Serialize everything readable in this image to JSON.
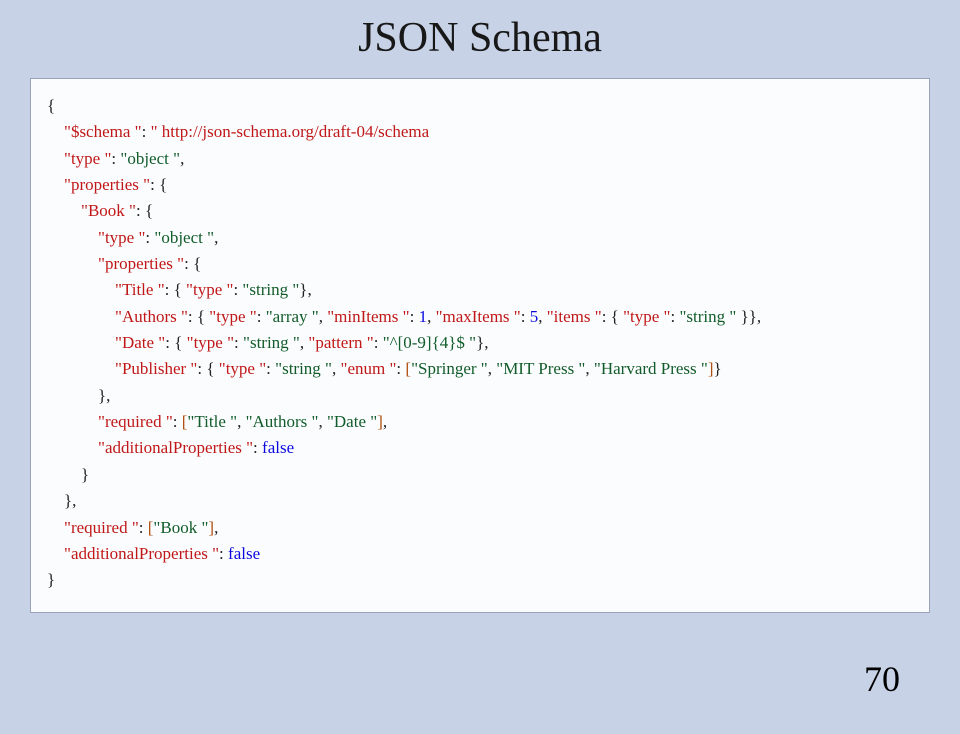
{
  "title": "JSON Schema",
  "pageNumber": "70",
  "code": {
    "l1": "{",
    "l2": {
      "indent": "    ",
      "key": "\"$schema \"",
      "colon": ": ",
      "val": "\" http://json-schema.org/draft-04/schema"
    },
    "l3": {
      "indent": "    ",
      "key": "\"type \"",
      "colon": ": ",
      "val": "\"object \"",
      "trail": ","
    },
    "l4": {
      "indent": "    ",
      "key": "\"properties \"",
      "colon": ": {"
    },
    "l5": {
      "indent": "        ",
      "key": "\"Book \"",
      "colon": ": {"
    },
    "l6": {
      "indent": "            ",
      "key": "\"type \"",
      "colon": ": ",
      "val": "\"object \"",
      "trail": ","
    },
    "l7": {
      "indent": "            ",
      "key": "\"properties \"",
      "colon": ": {"
    },
    "l8": {
      "indent": "                ",
      "key": "\"Title \"",
      "colon": ": { ",
      "k2": "\"type \"",
      "c2": ": ",
      "v2": "\"string \"",
      "end": "},"
    },
    "l9": {
      "indent": "                ",
      "key": "\"Authors \"",
      "colon": ": { ",
      "parts": [
        [
          "k",
          "\"type \""
        ],
        [
          "p",
          ": "
        ],
        [
          "s",
          "\"array \""
        ],
        [
          "p",
          ", "
        ],
        [
          "k",
          "\"minItems \""
        ],
        [
          "p",
          ": "
        ],
        [
          "n",
          "1"
        ],
        [
          "p",
          ", "
        ],
        [
          "k",
          "\"maxItems \""
        ],
        [
          "p",
          ": "
        ],
        [
          "n",
          "5"
        ],
        [
          "p",
          ", "
        ],
        [
          "k",
          "\"items \""
        ],
        [
          "p",
          ": { "
        ],
        [
          "k",
          "\"type \""
        ],
        [
          "p",
          ": "
        ],
        [
          "s",
          "\"string \""
        ],
        [
          "p",
          " }}"
        ]
      ],
      "trail": ","
    },
    "l10": {
      "indent": "                ",
      "key": "\"Date \"",
      "colon": ": { ",
      "parts": [
        [
          "k",
          "\"type \""
        ],
        [
          "p",
          ": "
        ],
        [
          "s",
          "\"string \""
        ],
        [
          "p",
          ", "
        ],
        [
          "k",
          "\"pattern \""
        ],
        [
          "p",
          ": "
        ],
        [
          "s",
          "\"^[0-9]{4}$ \""
        ],
        [
          "p",
          "}"
        ]
      ],
      "trail": ","
    },
    "l11": {
      "indent": "                ",
      "key": "\"Publisher \"",
      "colon": ": { ",
      "parts": [
        [
          "k",
          "\"type \""
        ],
        [
          "p",
          ": "
        ],
        [
          "s",
          "\"string \""
        ],
        [
          "p",
          ", "
        ],
        [
          "k",
          "\"enum \""
        ],
        [
          "p",
          ": "
        ],
        [
          "br",
          "["
        ],
        [
          "s",
          "\"Springer \""
        ],
        [
          "p",
          ", "
        ],
        [
          "s",
          "\"MIT Press \""
        ],
        [
          "p",
          ", "
        ],
        [
          "s",
          "\"Harvard Press \""
        ],
        [
          "br",
          "]"
        ],
        [
          "p",
          "}"
        ]
      ]
    },
    "l12": {
      "indent": "            ",
      "plain": "},"
    },
    "l13": {
      "indent": "            ",
      "key": "\"required \"",
      "colon": ": ",
      "br1": "[",
      "vals": [
        "\"Title \"",
        "\"Authors \"",
        "\"Date \""
      ],
      "br2": "]",
      "trail": ","
    },
    "l14": {
      "indent": "            ",
      "key": "\"additionalProperties \"",
      "colon": ": ",
      "bool": "false"
    },
    "l15": {
      "indent": "        ",
      "plain": "}"
    },
    "l16": {
      "indent": "    ",
      "plain": "},"
    },
    "l17": {
      "indent": "    ",
      "key": "\"required \"",
      "colon": ": ",
      "br1": "[",
      "vals": [
        "\"Book \""
      ],
      "br2": "]",
      "trail": ","
    },
    "l18": {
      "indent": "    ",
      "key": "\"additionalProperties \"",
      "colon": ": ",
      "bool": "false"
    },
    "l19": "}"
  }
}
